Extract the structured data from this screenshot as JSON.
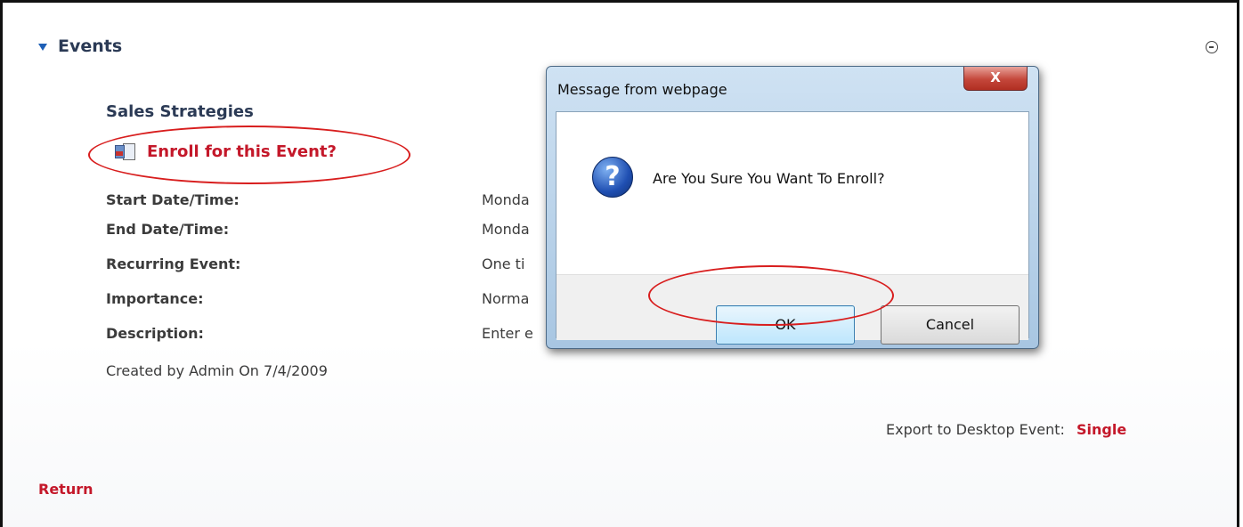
{
  "section": {
    "header": "Events"
  },
  "event": {
    "title": "Sales Strategies",
    "enroll_link": "Enroll for this Event?",
    "fields": [
      {
        "label": "Start Date/Time:",
        "value": "Monda"
      },
      {
        "label": "End Date/Time:",
        "value": "Monda"
      },
      {
        "label": "Recurring Event:",
        "value": "One ti"
      },
      {
        "label": "Importance:",
        "value": "Norma"
      },
      {
        "label": "Description:",
        "value": "Enter e"
      }
    ],
    "created": "Created by Admin On 7/4/2009"
  },
  "export": {
    "label": "Export to Desktop Event:",
    "link": "Single"
  },
  "return_link": "Return",
  "dialog": {
    "title": "Message from webpage",
    "close_glyph": "X",
    "icon_glyph": "?",
    "message": "Are You Sure You Want To Enroll?",
    "ok_label": "OK",
    "cancel_label": "Cancel"
  }
}
